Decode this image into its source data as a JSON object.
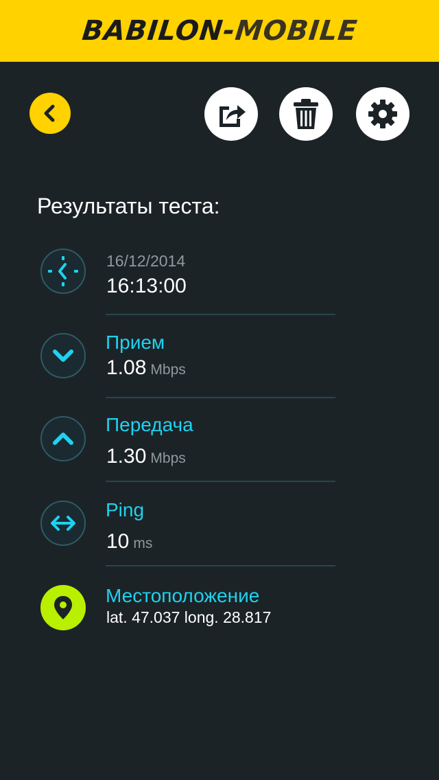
{
  "header": {
    "brand_part1": "BABILON",
    "brand_dash": "-",
    "brand_part2": "MOBILE"
  },
  "toolbar": {
    "back_icon": "chevron-left-icon",
    "share_icon": "share-icon",
    "delete_icon": "trash-icon",
    "settings_icon": "gear-icon"
  },
  "title": "Результаты теста:",
  "test": {
    "date": "16/12/2014",
    "time": "16:13:00"
  },
  "download": {
    "label": "Прием",
    "value": "1.08",
    "unit": "Mbps"
  },
  "upload": {
    "label": "Передача",
    "value": "1.30",
    "unit": "Mbps"
  },
  "ping": {
    "label": "Ping",
    "value": "10",
    "unit": "ms"
  },
  "location": {
    "label": "Местоположение",
    "coords": "lat. 47.037 long. 28.817"
  },
  "colors": {
    "brand_yellow": "#ffd200",
    "background": "#1c2326",
    "accent_cyan": "#1ed2f0",
    "location_green": "#b8f000"
  }
}
